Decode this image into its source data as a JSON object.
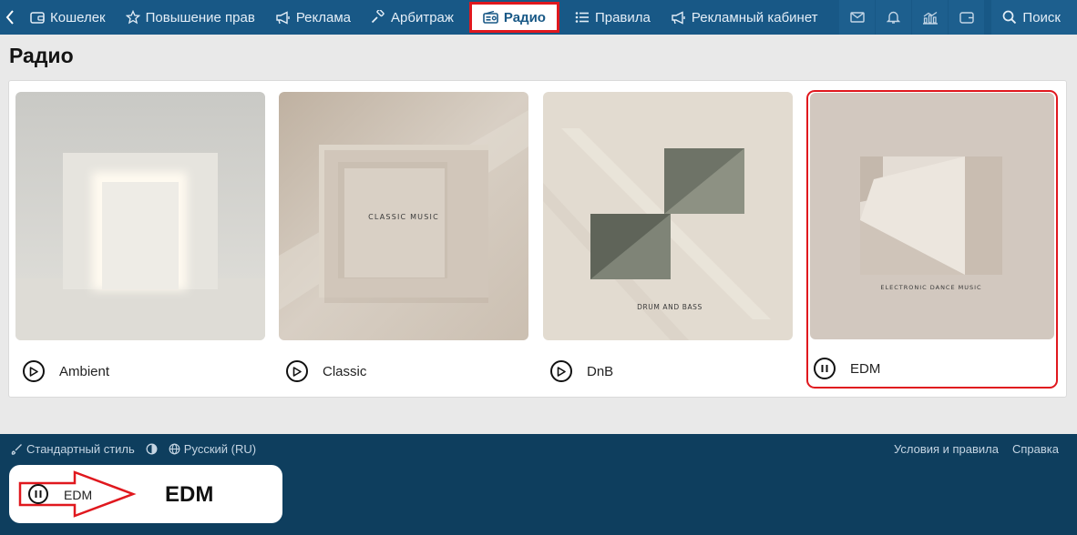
{
  "nav": {
    "items": [
      {
        "label": "Кошелек",
        "icon": "wallet-icon"
      },
      {
        "label": "Повышение прав",
        "icon": "star-icon"
      },
      {
        "label": "Реклама",
        "icon": "megaphone-icon"
      },
      {
        "label": "Арбитраж",
        "icon": "gavel-icon"
      },
      {
        "label": "Радио",
        "icon": "radio-icon",
        "active": true
      },
      {
        "label": "Правила",
        "icon": "list-icon"
      },
      {
        "label": "Рекламный кабинет",
        "icon": "megaphone-icon"
      }
    ],
    "search_label": "Поиск",
    "right_icons": [
      "mail-icon",
      "bell-icon",
      "chart-icon",
      "wallet-icon"
    ]
  },
  "page": {
    "title": "Радио"
  },
  "stations": [
    {
      "name": "Ambient",
      "state": "play",
      "cover_text": ""
    },
    {
      "name": "Classic",
      "state": "play",
      "cover_text": "CLASSIC MUSIC"
    },
    {
      "name": "DnB",
      "state": "play",
      "cover_text": "DRUM AND BASS"
    },
    {
      "name": "EDM",
      "state": "pause",
      "cover_text": "ELECTRONIC DANCE MUSIC",
      "selected": true
    }
  ],
  "footer": {
    "style_label": "Стандартный стиль",
    "language_label": "Русский (RU)",
    "links": [
      "Условия и правила",
      "Справка"
    ]
  },
  "player": {
    "station": "EDM",
    "state": "pause",
    "annotation": "EDM"
  },
  "colors": {
    "nav_bg": "#185886",
    "footer_bg": "#0e3e5e",
    "highlight": "#e0181e"
  }
}
